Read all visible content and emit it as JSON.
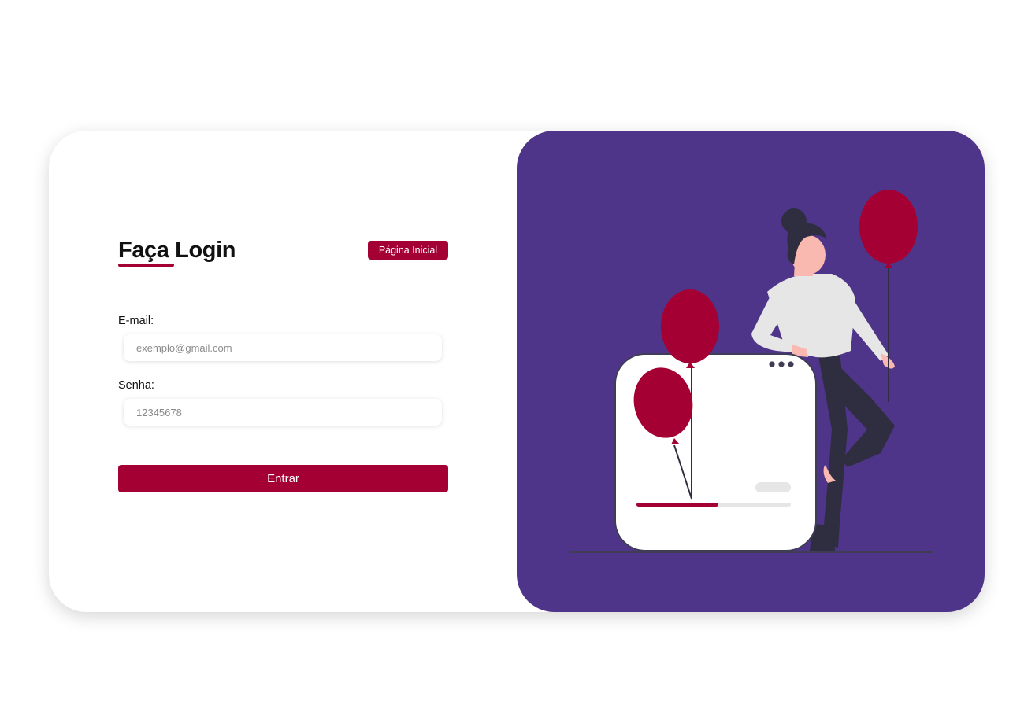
{
  "login": {
    "title": "Faça Login",
    "home_button": "Página Inicial",
    "email_label": "E-mail:",
    "email_placeholder": "exemplo@gmail.com",
    "email_value": "",
    "password_label": "Senha:",
    "password_placeholder": "12345678",
    "password_value": "",
    "submit_label": "Entrar"
  },
  "illustration": {
    "name": "woman-with-balloons-illustration",
    "progress_fraction": 0.53
  },
  "colors": {
    "accent": "#a50034",
    "panel_background": "#4f3589",
    "page_background": "#ffffff"
  }
}
